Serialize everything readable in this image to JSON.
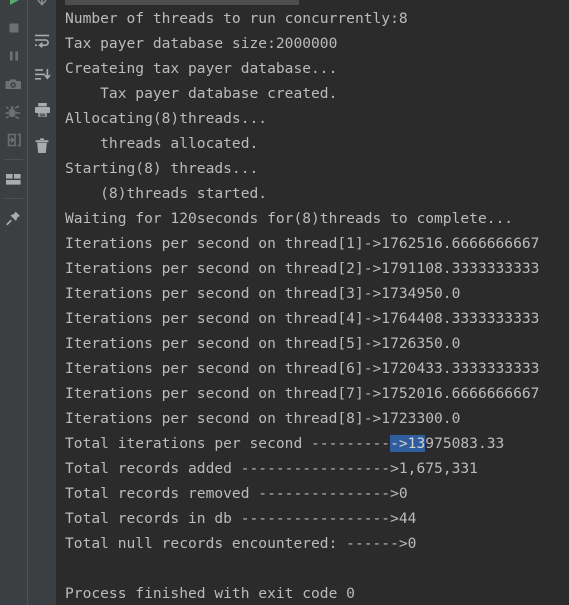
{
  "window": {
    "background_color": "#2b2b2b",
    "gutter_color": "#3c3f41",
    "text_color": "#bbbbbb",
    "selection_color": "#2f5d9e"
  },
  "toolbar_primary": {
    "name": "run-tool-window-actions",
    "buttons": [
      {
        "id": "rerun",
        "icon": "green-play-icon",
        "label": "Rerun"
      },
      {
        "id": "stop",
        "icon": "stop-square-icon",
        "label": "Stop"
      },
      {
        "id": "pause",
        "icon": "pause-icon",
        "label": "Pause Output"
      },
      {
        "id": "screenshot",
        "icon": "camera-icon",
        "label": "Take Screenshot"
      },
      {
        "id": "debug",
        "icon": "bug-icon",
        "label": "Attach Debugger"
      },
      {
        "id": "export",
        "icon": "export-arrow-icon",
        "label": "Export"
      },
      {
        "id": "layout",
        "icon": "layout-panel-icon",
        "label": "Layout Settings"
      },
      {
        "id": "pin",
        "icon": "pin-icon",
        "label": "Pin Tab"
      }
    ]
  },
  "toolbar_secondary": {
    "name": "console-actions",
    "buttons": [
      {
        "id": "scroll-to-end",
        "icon": "down-arrow-icon",
        "label": "Scroll to End"
      },
      {
        "id": "soft-wrap",
        "icon": "soft-wrap-icon",
        "label": "Soft-Wrap"
      },
      {
        "id": "filter-sort",
        "icon": "sort-filter-icon",
        "label": "Filter / Sort"
      },
      {
        "id": "print",
        "icon": "printer-icon",
        "label": "Print"
      },
      {
        "id": "clear-all",
        "icon": "trash-icon",
        "label": "Clear All"
      }
    ]
  },
  "console": {
    "name": "run-output-console",
    "has_partial_top_line": true,
    "lines": [
      {
        "text": "Number of threads to run concurrently:8"
      },
      {
        "text": "Tax payer database size:2000000"
      },
      {
        "text": "Createing tax payer database..."
      },
      {
        "text": "    Tax payer database created."
      },
      {
        "text": "Allocating(8)threads..."
      },
      {
        "text": "    threads allocated."
      },
      {
        "text": "Starting(8) threads..."
      },
      {
        "text": "    (8)threads started."
      },
      {
        "text": "Waiting for 120seconds for(8)threads to complete..."
      },
      {
        "text": "Iterations per second on thread[1]->1762516.6666666667"
      },
      {
        "text": "Iterations per second on thread[2]->1791108.3333333333"
      },
      {
        "text": "Iterations per second on thread[3]->1734950.0"
      },
      {
        "text": "Iterations per second on thread[4]->1764408.3333333333"
      },
      {
        "text": "Iterations per second on thread[5]->1726350.0"
      },
      {
        "text": "Iterations per second on thread[6]->1720433.3333333333"
      },
      {
        "text": "Iterations per second on thread[7]->1752016.6666666667"
      },
      {
        "text": "Iterations per second on thread[8]->1723300.0"
      },
      {
        "text": "Total iterations per second ---------->13975083.33",
        "selection": {
          "start": 37,
          "end": 41,
          "selected_text": "1397"
        }
      },
      {
        "text": "Total records added ----------------->1,675,331"
      },
      {
        "text": "Total records removed --------------->0"
      },
      {
        "text": "Total records in db ----------------->44"
      },
      {
        "text": "Total null records encountered: ------>0"
      },
      {
        "text": ""
      },
      {
        "text": "Process finished with exit code 0"
      }
    ]
  }
}
